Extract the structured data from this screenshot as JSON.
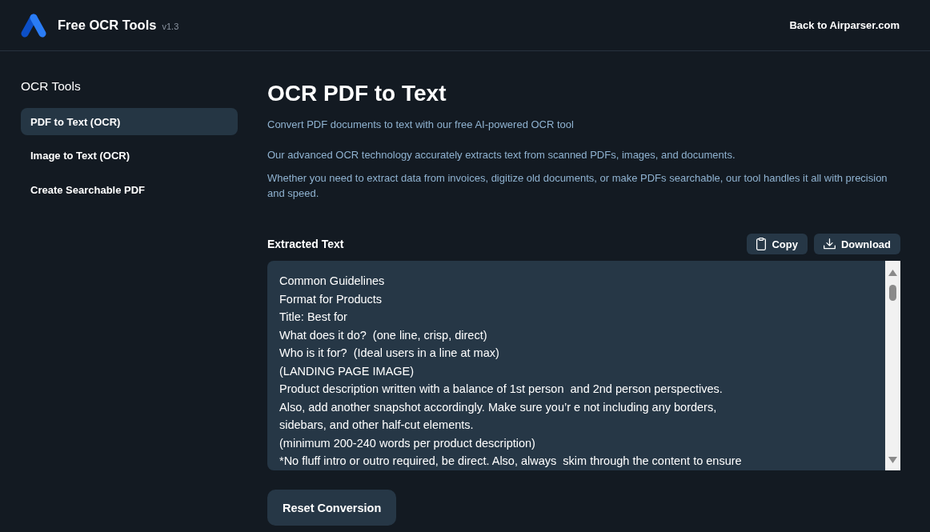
{
  "header": {
    "app_name": "Free OCR Tools",
    "version": "v1.3",
    "back_link": "Back to Airparser.com"
  },
  "sidebar": {
    "title": "OCR Tools",
    "items": [
      {
        "label": "PDF to Text (OCR)",
        "selected": true
      },
      {
        "label": "Image to Text (OCR)",
        "selected": false
      },
      {
        "label": "Create Searchable PDF",
        "selected": false
      }
    ]
  },
  "main": {
    "title": "OCR PDF to Text",
    "subtitle": "Convert PDF documents to text with our free AI-powered OCR tool",
    "paragraphs": [
      "Our advanced OCR technology accurately extracts text from scanned PDFs, images, and documents.",
      "Whether you need to extract data from invoices, digitize old documents, or make PDFs searchable, our tool handles it all with precision and speed."
    ],
    "extracted_text": {
      "label": "Extracted Text",
      "actions": [
        {
          "kind": "copy",
          "label": "Copy"
        },
        {
          "kind": "download",
          "label": "Download"
        }
      ],
      "lines": [
        "Common Guidelines",
        "Format for Products",
        "Title: Best for",
        "What does it do?  (one line, crisp, direct)",
        "Who is it for?  (Ideal users in a line at max)",
        "(LANDING PAGE IMAGE)",
        "Product description written with a balance of 1st person  and 2nd person perspectives.",
        "Also, add another snapshot accordingly. Make sure you’r e not including any borders,",
        "sidebars, and other half-cut elements.",
        "(minimum 200-240 words per product description)",
        "*No fluff intro or outro required, be direct. Also, always  skim through the content to ensure"
      ]
    },
    "reset_button": "Reset Conversion"
  }
}
